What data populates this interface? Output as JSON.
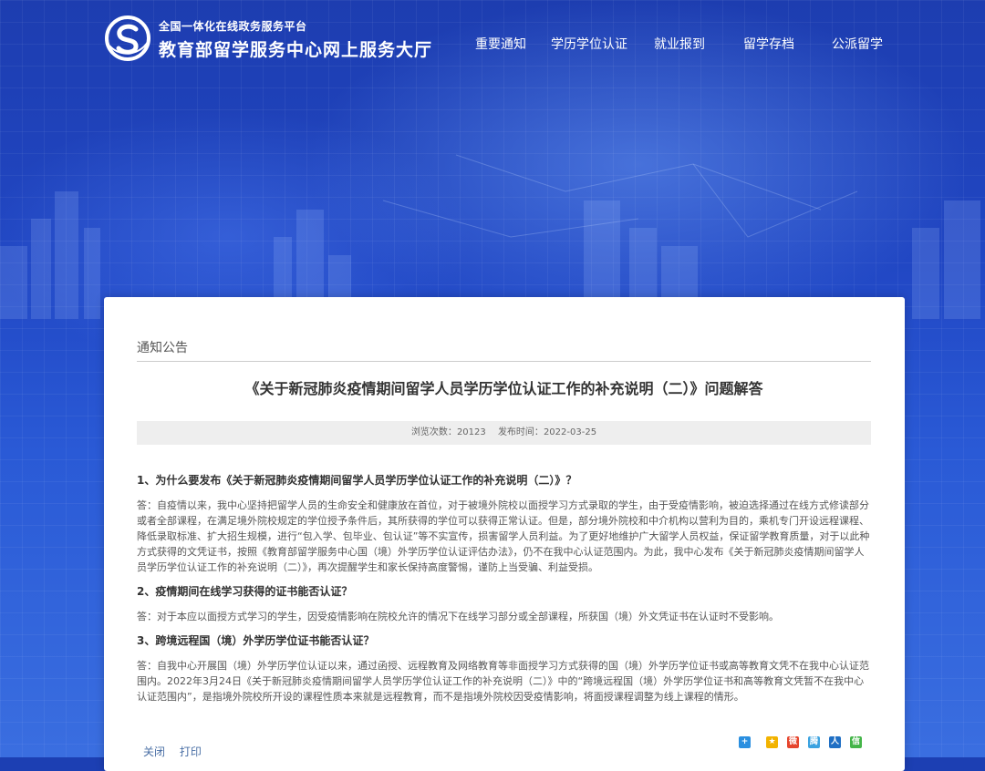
{
  "header": {
    "platform": "全国一体化在线政务服务平台",
    "site_name": "教育部留学服务中心网上服务大厅"
  },
  "nav": [
    {
      "label": "重要通知"
    },
    {
      "label": "学历学位认证"
    },
    {
      "label": "就业报到"
    },
    {
      "label": "留学存档"
    },
    {
      "label": "公派留学"
    }
  ],
  "article": {
    "section": "通知公告",
    "title": "《关于新冠肺炎疫情期间留学人员学历学位认证工作的补充说明（二）》问题解答",
    "views_label": "浏览次数：",
    "views": "20123",
    "published_label": "发布时间：",
    "published": "2022-03-25",
    "qa": [
      {
        "q": "1、为什么要发布《关于新冠肺炎疫情期间留学人员学历学位认证工作的补充说明（二）》？",
        "a": "答：自疫情以来，我中心坚持把留学人员的生命安全和健康放在首位，对于被境外院校以面授学习方式录取的学生，由于受疫情影响，被迫选择通过在线方式修读部分或者全部课程，在满足境外院校规定的学位授予条件后，其所获得的学位可以获得正常认证。但是，部分境外院校和中介机构以营利为目的，乘机专门开设远程课程、降低录取标准、扩大招生规模，进行“包入学、包毕业、包认证”等不实宣传，损害留学人员利益。为了更好地维护广大留学人员权益，保证留学教育质量，对于以此种方式获得的文凭证书，按照《教育部留学服务中心国（境）外学历学位认证评估办法》，仍不在我中心认证范围内。为此，我中心发布《关于新冠肺炎疫情期间留学人员学历学位认证工作的补充说明（二）》，再次提醒学生和家长保持高度警惕，谨防上当受骗、利益受损。"
      },
      {
        "q": "2、疫情期间在线学习获得的证书能否认证？",
        "a": "答：对于本应以面授方式学习的学生，因受疫情影响在院校允许的情况下在线学习部分或全部课程，所获国（境）外文凭证书在认证时不受影响。"
      },
      {
        "q": "3、跨境远程国（境）外学历学位证书能否认证？",
        "a": "答：自我中心开展国（境）外学历学位认证以来，通过函授、远程教育及网络教育等非面授学习方式获得的国（境）外学历学位证书或高等教育文凭不在我中心认证范围内。2022年3月24日《关于新冠肺炎疫情期间留学人员学历学位认证工作的补充说明（二）》中的“跨境远程国（境）外学历学位证书和高等教育文凭暂不在我中心认证范围内”，是指境外院校所开设的课程性质本来就是远程教育，而不是指境外院校因受疫情影响，将面授课程调整为线上课程的情形。"
      }
    ],
    "close_label": "关闭",
    "print_label": "打印"
  },
  "share": [
    {
      "icon": "share-plus-icon",
      "color": "#2a8fe0",
      "glyph": "+"
    },
    {
      "icon": "qzone-icon",
      "color": "#f2b300",
      "glyph": "★"
    },
    {
      "icon": "weibo-icon",
      "color": "#e6452d",
      "glyph": "微"
    },
    {
      "icon": "tencent-weibo-icon",
      "color": "#3aa2e0",
      "glyph": "腾"
    },
    {
      "icon": "renren-icon",
      "color": "#1f6fc4",
      "glyph": "人"
    },
    {
      "icon": "wechat-icon",
      "color": "#44b549",
      "glyph": "信"
    }
  ]
}
